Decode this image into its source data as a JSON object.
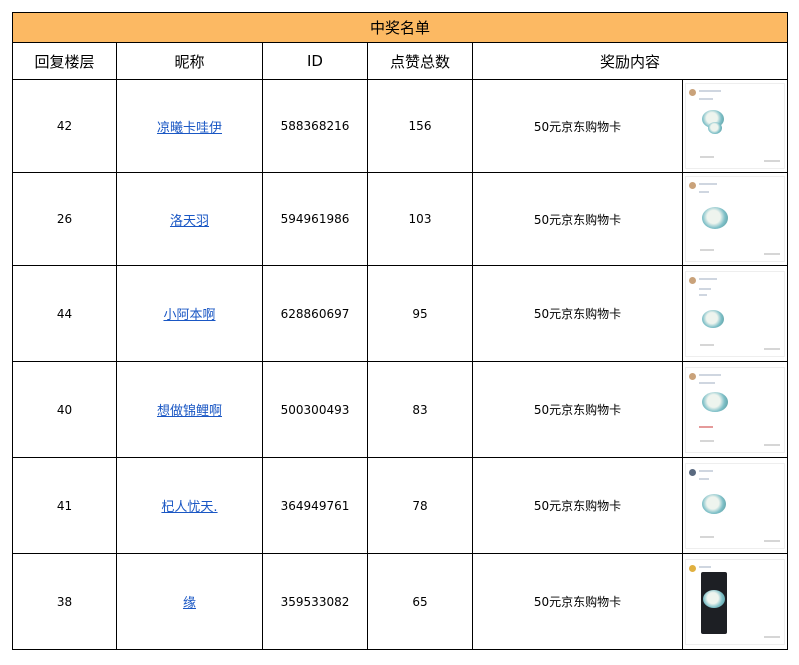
{
  "title": "中奖名单",
  "headers": [
    "回复楼层",
    "昵称",
    "ID",
    "点赞总数",
    "奖励内容"
  ],
  "rows": [
    {
      "floor": "42",
      "nickname": "凉曦卡哇伊",
      "id": "588368216",
      "likes": "156",
      "reward": "50元京东购物卡"
    },
    {
      "floor": "26",
      "nickname": "洛天羽",
      "id": "594961986",
      "likes": "103",
      "reward": "50元京东购物卡"
    },
    {
      "floor": "44",
      "nickname": "小阿本啊",
      "id": "628860697",
      "likes": "95",
      "reward": "50元京东购物卡"
    },
    {
      "floor": "40",
      "nickname": "想做锦鲤啊",
      "id": "500300493",
      "likes": "83",
      "reward": "50元京东购物卡"
    },
    {
      "floor": "41",
      "nickname": "杞人忧天.",
      "id": "364949761",
      "likes": "78",
      "reward": "50元京东购物卡"
    },
    {
      "floor": "38",
      "nickname": "缘",
      "id": "359533082",
      "likes": "65",
      "reward": "50元京东购物卡"
    }
  ],
  "colors": {
    "title_bg": "#fcb963",
    "link": "#1a57c4",
    "border": "#000000"
  }
}
